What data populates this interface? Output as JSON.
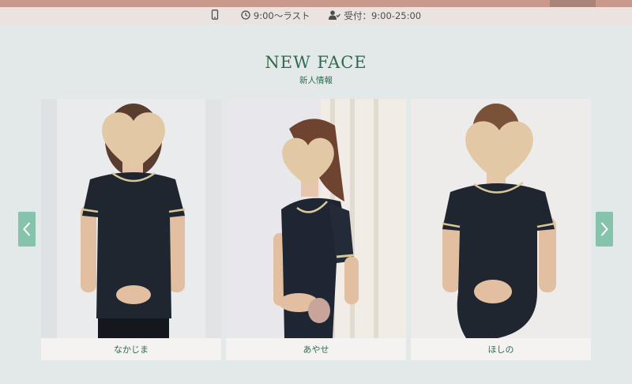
{
  "info_bar": {
    "hours": "9:00〜ラスト",
    "reception": "受付：9:00-25:00"
  },
  "section": {
    "title": "NEW FACE",
    "subtitle": "新人情報"
  },
  "cards": [
    {
      "name": "なかじま"
    },
    {
      "name": "あやせ"
    },
    {
      "name": "ほしの"
    }
  ],
  "colors": {
    "accent": "#2e6b50",
    "arrow": "#86c3ac",
    "stripe": "#c99a8c",
    "heart": "#e2c8a4",
    "uniform": "#1f2630",
    "trim": "#d8c79a"
  },
  "icons": {
    "phone": "phone-icon",
    "clock": "clock-icon",
    "user": "user-check-icon",
    "heart": "heart-icon",
    "prev": "chevron-left-icon",
    "next": "chevron-right-icon"
  }
}
